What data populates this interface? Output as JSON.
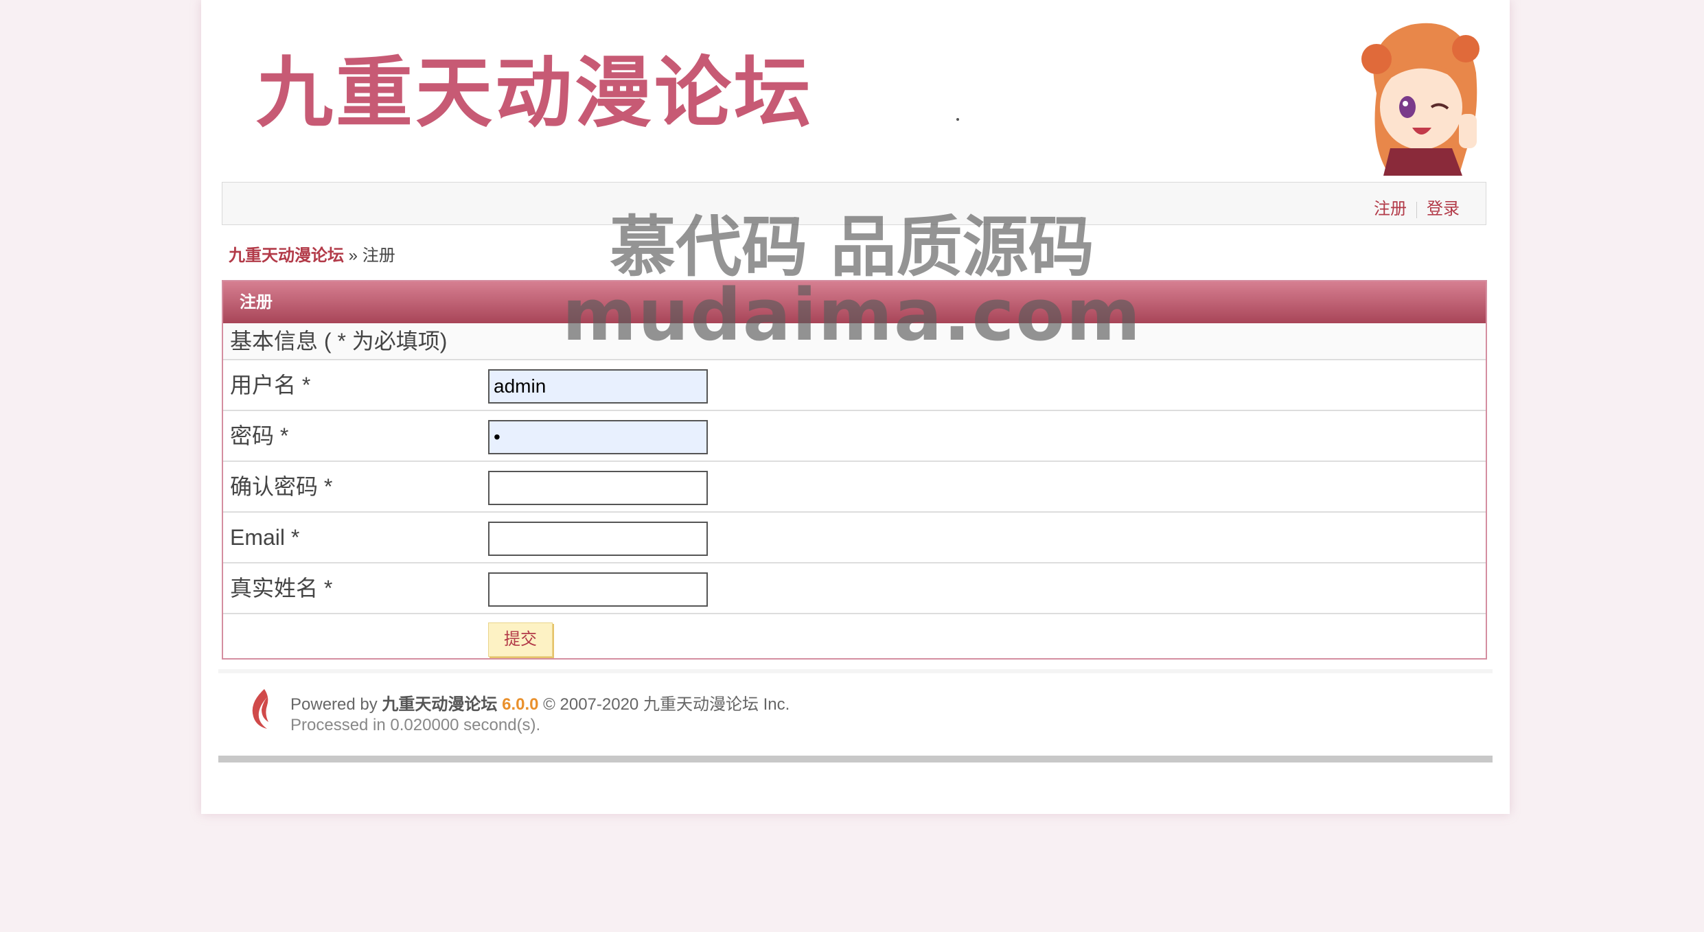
{
  "header": {
    "logo_text": "九重天动漫论坛"
  },
  "nav": {
    "register": "注册",
    "login": "登录"
  },
  "breadcrumb": {
    "home": "九重天动漫论坛",
    "separator": "»",
    "current": "注册"
  },
  "form": {
    "title": "注册",
    "section": "基本信息 ( * 为必填项)",
    "fields": [
      {
        "label": "用户名 *",
        "value": "admin"
      },
      {
        "label": "密码 *",
        "value": "•"
      },
      {
        "label": "确认密码 *",
        "value": ""
      },
      {
        "label": "Email *",
        "value": ""
      },
      {
        "label": "真实姓名 *",
        "value": ""
      }
    ],
    "submit": "提交"
  },
  "footer": {
    "powered_by": "Powered by",
    "brand": "九重天动漫论坛",
    "version": "6.0.0",
    "copyright": "© 2007-2020 九重天动漫论坛 Inc.",
    "processed": "Processed in 0.020000 second(s)."
  },
  "watermark": {
    "line1": "慕代码 品质源码",
    "line2": "mudaima.com"
  },
  "colors": {
    "accent": "#b23a48",
    "header_gradient_top": "#d67f91",
    "header_gradient_bottom": "#a84558",
    "version": "#e9902c"
  },
  "icons": [
    "mascot-image",
    "forum-flame-icon"
  ]
}
